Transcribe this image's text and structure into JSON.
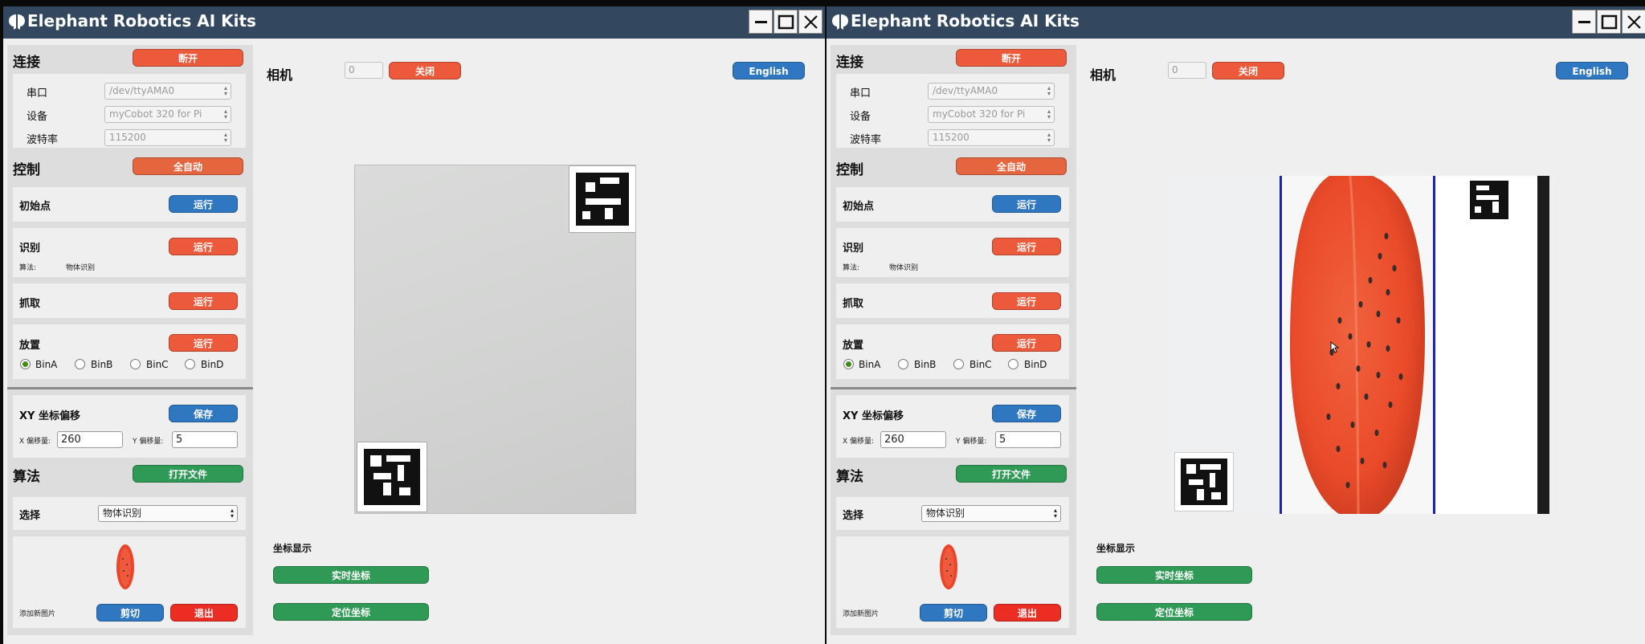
{
  "app": {
    "title": "Elephant Robotics AI Kits"
  },
  "sidebar": {
    "connection": {
      "title": "连接",
      "disconnect_label": "断开"
    },
    "serial": {
      "label": "串口",
      "value": "/dev/ttyAMA0"
    },
    "device": {
      "label": "设备",
      "value": "myCobot 320 for Pi"
    },
    "baud": {
      "label": "波特率",
      "value": "115200"
    },
    "control": {
      "title": "控制",
      "auto_label": "全自动"
    },
    "home": {
      "label": "初始点",
      "run_label": "运行"
    },
    "recognize": {
      "label": "识别",
      "run_label": "运行",
      "algo_label": "算法:",
      "algo_value": "物体识别"
    },
    "grab": {
      "label": "抓取",
      "run_label": "运行"
    },
    "place": {
      "label": "放置",
      "run_label": "运行",
      "bins": [
        "BinA",
        "BinB",
        "BinC",
        "BinD"
      ],
      "selected_bin": "BinA"
    },
    "offset": {
      "title": "XY 坐标偏移",
      "save_label": "保存",
      "x_label": "X 偏移量:",
      "x_value": "260",
      "y_label": "Y 偏移量:",
      "y_value": "5"
    },
    "algorithm": {
      "title": "算法",
      "open_file_label": "打开文件",
      "select_label": "选择",
      "select_value": "物体识别"
    },
    "image": {
      "add_label": "添加新图片",
      "cut_label": "剪切",
      "exit_label": "退出"
    }
  },
  "main": {
    "camera_label": "相机",
    "camera_index": "0",
    "close_label": "关闭",
    "language_label": "English",
    "coords_label": "坐标显示",
    "realtime_label": "实时坐标",
    "locate_label": "定位坐标"
  },
  "colors": {
    "titlebar": "#33475e",
    "red_button": "#ec5a3b",
    "blue_button": "#2f78c1",
    "green_button": "#2e9a55",
    "exit_button": "#ec2d24"
  },
  "icons": [
    "app-logo-icon",
    "minimize-icon",
    "maximize-icon",
    "close-icon",
    "dropdown-arrow-icon",
    "mouse-cursor-icon"
  ]
}
